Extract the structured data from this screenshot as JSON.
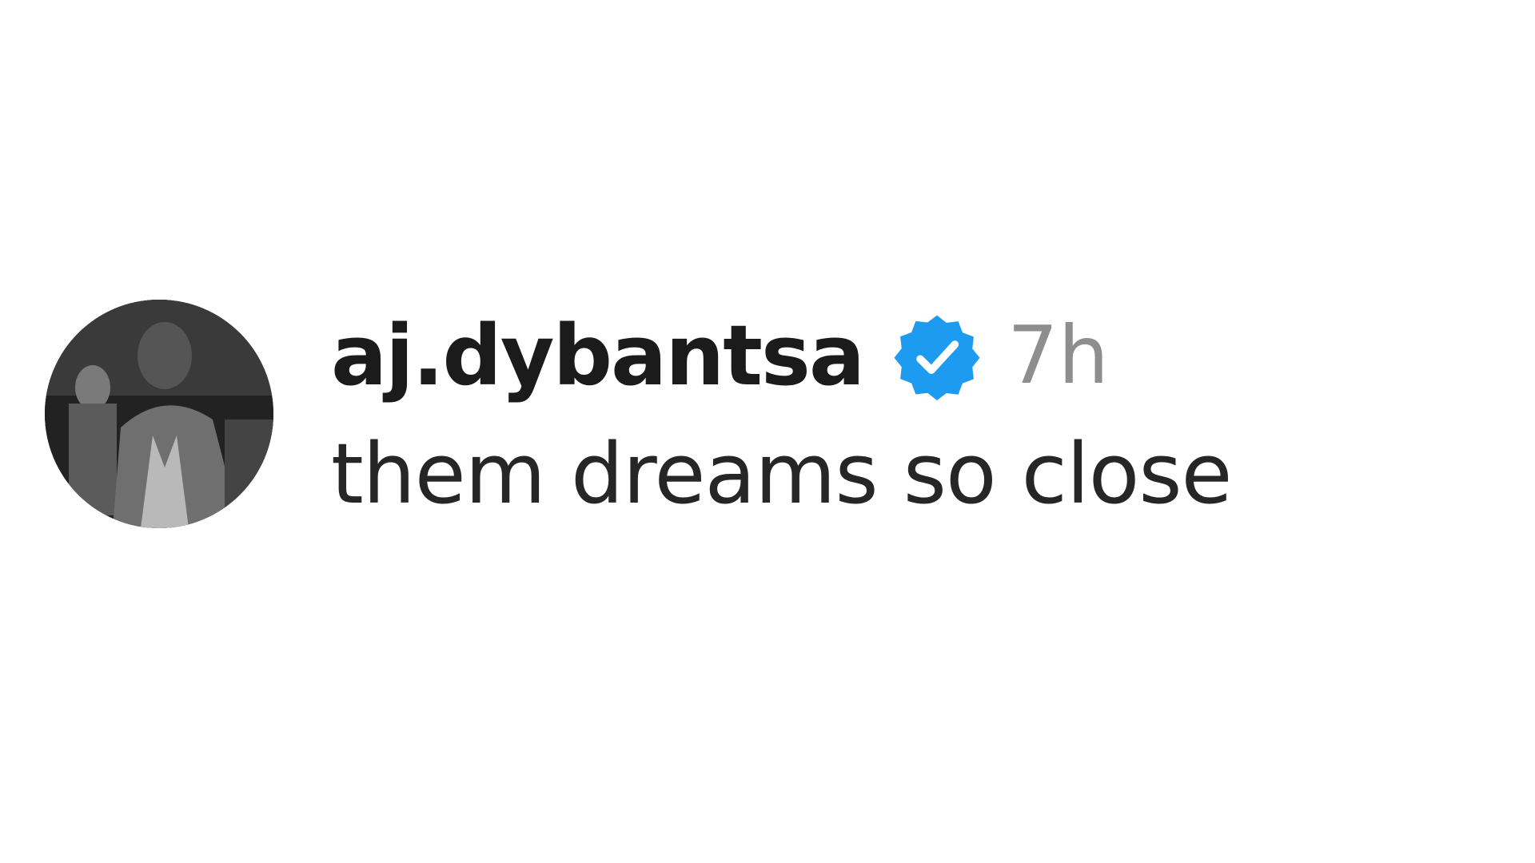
{
  "comment": {
    "avatar_icon": "user-avatar-photo",
    "username": "aj.dybantsa",
    "verified_icon": "verified-badge-icon",
    "timestamp": "7h",
    "text": "them dreams so close"
  },
  "colors": {
    "username": "#1b1b1b",
    "text": "#262626",
    "timestamp": "#8e8e8e",
    "verified": "#1d9bf0"
  }
}
